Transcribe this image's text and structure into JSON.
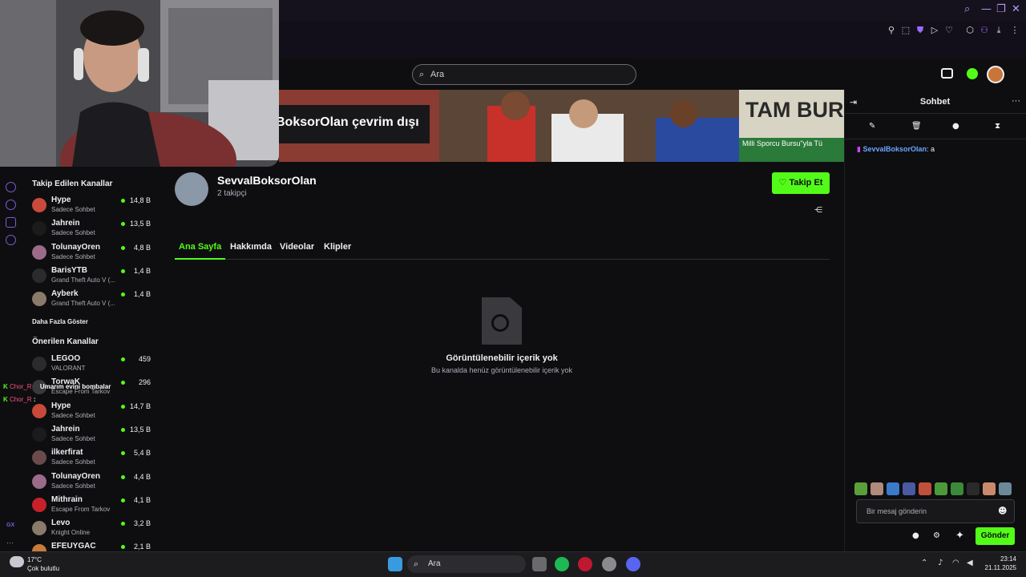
{
  "browser": {
    "window_controls": [
      "⌕",
      "—",
      "❐",
      "✕"
    ],
    "extension_icons": [
      "pin-icon",
      "screenshot-icon",
      "shield-icon",
      "play-icon",
      "heart-icon",
      "puzzle-icon",
      "profile-icon",
      "download-icon",
      "menu-icon"
    ]
  },
  "topbar": {
    "search_placeholder": "Ara"
  },
  "banner": {
    "offline_text": "BoksorOlan çevrim dışı",
    "right_text_1": "TAM BUR",
    "right_text_2": "Milli Sporcu Bursu\"yla Tü"
  },
  "sidebar": {
    "followed_title": "Takip Edilen Kanallar",
    "followed": [
      {
        "name": "Hype",
        "game": "Sadece Sohbet",
        "viewers": "14,8 B",
        "color": "#c94a3a"
      },
      {
        "name": "Jahrein",
        "game": "Sadece Sohbet",
        "viewers": "13,5 B",
        "color": "#1b1b1b"
      },
      {
        "name": "TolunayOren",
        "game": "Sadece Sohbet",
        "viewers": "4,8 B",
        "color": "#9b6b8a"
      },
      {
        "name": "BarisYTB",
        "game": "Grand Theft Auto V (...",
        "viewers": "1,4 B",
        "color": "#2b2b2b"
      },
      {
        "name": "Ayberk",
        "game": "Grand Theft Auto V (...",
        "viewers": "1,4 B",
        "color": "#8a7a6a"
      }
    ],
    "show_more": "Daha Fazla Göster",
    "recommended_title": "Önerilen Kanallar",
    "recommended": [
      {
        "name": "LEGOO",
        "game": "VALORANT",
        "viewers": "459",
        "color": "#2b2b2b"
      },
      {
        "name": "TorwaK",
        "game": "Escape From Tarkov",
        "viewers": "296",
        "color": "#3a3a3a"
      },
      {
        "name": "Hype",
        "game": "Sadece Sohbet",
        "viewers": "14,7 B",
        "color": "#c94a3a"
      },
      {
        "name": "Jahrein",
        "game": "Sadece Sohbet",
        "viewers": "13,5 B",
        "color": "#1b1b1b"
      },
      {
        "name": "ilkerfirat",
        "game": "Sadece Sohbet",
        "viewers": "5,4 B",
        "color": "#6a4a4a"
      },
      {
        "name": "TolunayOren",
        "game": "Sadece Sohbet",
        "viewers": "4,4 B",
        "color": "#9b6b8a"
      },
      {
        "name": "Mithrain",
        "game": "Escape From Tarkov",
        "viewers": "4,1 B",
        "color": "#c8202a"
      },
      {
        "name": "Levo",
        "game": "Knight Online",
        "viewers": "3,2 B",
        "color": "#8a7a6a"
      },
      {
        "name": "EFEUYGAC",
        "game": "",
        "viewers": "2,1 B",
        "color": "#c87a3a"
      }
    ]
  },
  "rail": {
    "gx_label": "GX",
    "more_label": "···"
  },
  "overlay_chat": [
    {
      "user": "Chor_R",
      "message": "Umarım evini bombalar"
    },
    {
      "user": "Chor_R",
      "message": ":"
    }
  ],
  "profile": {
    "name": "SevvalBoksorOlan",
    "followers": "2 takipçi",
    "follow_label": "Takip Et",
    "tabs": [
      "Ana Sayfa",
      "Hakkımda",
      "Videolar",
      "Klipler"
    ],
    "empty_title": "Görüntülenebilir içerik yok",
    "empty_subtitle": "Bu kanalda henüz görüntülenebilir içerik yok"
  },
  "chat": {
    "title": "Sohbet",
    "messages": [
      {
        "user": "SevvalBoksorOlan",
        "text": ": a"
      }
    ],
    "input_placeholder": "Bir mesaj gönderin",
    "send_label": "Gönder"
  },
  "taskbar": {
    "weather_temp": "17°C",
    "weather_desc": "Çok bulutlu",
    "search_placeholder": "Ara",
    "time": "23:14",
    "date": "21.11.2025"
  },
  "colors": {
    "accent": "#53fc18",
    "background": "#0e0e10",
    "opera_purple": "#7d5ad8"
  }
}
